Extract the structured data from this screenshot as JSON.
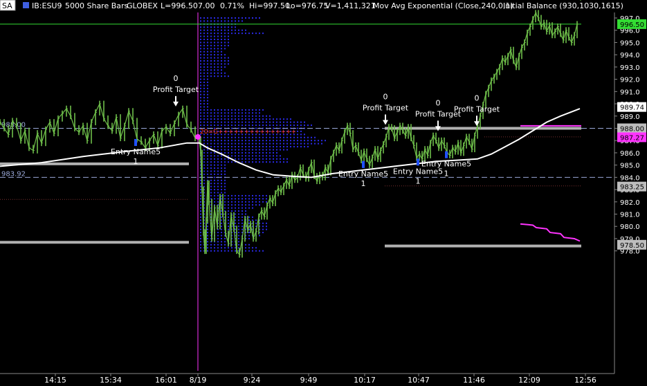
{
  "header": {
    "symbol_button": "SA",
    "symbol": "IB:ESU9",
    "bar_type": "5000 Share Bars",
    "exchange": "GLOBEX",
    "last": "L=996.50",
    "change": "7.00",
    "change_pct": "0.71%",
    "high": "Hi=997.50",
    "low": "Lo=976.75",
    "volume": "V=1,411,321",
    "study1": "Mov Avg Exponential (Close,240,0,1)",
    "study2": "Initial Balance (930,1030,1615)"
  },
  "colors": {
    "background": "#000000",
    "bars": "#6fbf4a",
    "moving_average": "#ffffff",
    "volume_profile": "#2a2ae6",
    "highlight_line": "#33dd33",
    "magenta": "#ff33ff",
    "ib_gray": "#b0b0b0",
    "dashed_level": "#9aa8d8",
    "last_badge": "#33dd33"
  },
  "chart_data": {
    "type": "line",
    "symbol": "IB:ESU9",
    "x_labels": [
      "14:15",
      "15:34",
      "16:01",
      "8/19",
      "9:24",
      "9:49",
      "10:17",
      "10:47",
      "11:46",
      "12:09",
      "12:56"
    ],
    "ylim": [
      977.5,
      997.5
    ],
    "y_ticks": [
      978.0,
      979.0,
      980.0,
      981.0,
      982.0,
      983.0,
      984.0,
      985.0,
      986.0,
      987.0,
      988.0,
      989.0,
      990.0,
      991.0,
      992.0,
      993.0,
      994.0,
      995.0,
      996.0,
      997.0
    ],
    "price_series": {
      "name": "IB:ESU9",
      "x": [
        0,
        6,
        12,
        18,
        24,
        30,
        36,
        42,
        48,
        54,
        60,
        66,
        72,
        78,
        84,
        90,
        96,
        102,
        108,
        114,
        120,
        126,
        132,
        138,
        144,
        150,
        156,
        162,
        168,
        174,
        180,
        186,
        192,
        198,
        204,
        210,
        216,
        222,
        228,
        234,
        240,
        246,
        252,
        258,
        264,
        270,
        276,
        282,
        288,
        290,
        292,
        294,
        296,
        298,
        300,
        302,
        306,
        310,
        314,
        318,
        322,
        326,
        330,
        334,
        338,
        342,
        346,
        350,
        354,
        358,
        362,
        366,
        370,
        374,
        378,
        382,
        386,
        390,
        394,
        398,
        402,
        406,
        410,
        414,
        418,
        422,
        426,
        430,
        434,
        438,
        442,
        446,
        450,
        454,
        458,
        462,
        466,
        470,
        474,
        478,
        482,
        486,
        490,
        494,
        498,
        502,
        506,
        510,
        514,
        518,
        522,
        526,
        530,
        534,
        538,
        542,
        546,
        550,
        554,
        558,
        562,
        566,
        570,
        574,
        578,
        582,
        586,
        590,
        594,
        598,
        602,
        606,
        610,
        614,
        618,
        622,
        626,
        630,
        634,
        638,
        642,
        646,
        650,
        654,
        658,
        662,
        666,
        670,
        674,
        678,
        682,
        686,
        690,
        694,
        698,
        702,
        706,
        710,
        714,
        718,
        722,
        726,
        730,
        734,
        738,
        742,
        746,
        750,
        754,
        758,
        762,
        766,
        770,
        774,
        778,
        782,
        786,
        790,
        794,
        798,
        802,
        806,
        810,
        814,
        818,
        822,
        826,
        830,
        834,
        838
      ],
      "y": [
        988.5,
        988.0,
        987.5,
        988.6,
        988.2,
        987.0,
        987.8,
        986.4,
        986.2,
        987.6,
        986.8,
        987.9,
        988.5,
        987.6,
        988.8,
        989.2,
        989.6,
        989.0,
        988.0,
        987.7,
        988.2,
        987.0,
        988.5,
        989.3,
        990.0,
        988.8,
        988.2,
        987.8,
        988.9,
        987.2,
        988.2,
        989.4,
        988.6,
        987.1,
        986.9,
        986.4,
        987.0,
        987.5,
        986.6,
        987.8,
        988.1,
        987.6,
        988.4,
        989.1,
        989.6,
        988.3,
        987.9,
        987.2,
        987.1,
        986.0,
        983.0,
        979.5,
        978.0,
        980.5,
        983.5,
        982.0,
        979.0,
        981.5,
        980.0,
        982.4,
        981.0,
        979.4,
        978.6,
        980.9,
        979.8,
        978.0,
        977.7,
        979.0,
        980.6,
        979.7,
        980.2,
        979.0,
        979.6,
        980.8,
        981.3,
        980.8,
        981.7,
        982.3,
        981.9,
        982.7,
        983.1,
        982.8,
        983.3,
        983.8,
        983.3,
        984.2,
        983.8,
        984.0,
        984.8,
        984.2,
        983.9,
        984.6,
        985.2,
        984.1,
        983.7,
        984.2,
        984.0,
        984.8,
        984.4,
        985.5,
        986.0,
        986.6,
        986.2,
        987.0,
        987.7,
        988.2,
        987.6,
        986.3,
        986.6,
        986.0,
        985.4,
        986.1,
        985.5,
        985.0,
        985.6,
        986.3,
        985.5,
        986.2,
        986.7,
        987.3,
        988.1,
        988.0,
        987.2,
        987.7,
        988.2,
        987.8,
        987.4,
        988.1,
        987.2,
        986.6,
        985.6,
        985.9,
        985.5,
        986.3,
        985.8,
        986.8,
        987.4,
        987.0,
        986.4,
        987.0,
        986.6,
        986.0,
        985.8,
        986.4,
        986.1,
        986.8,
        986.0,
        986.6,
        987.3,
        986.9,
        986.3,
        987.4,
        988.2,
        989.0,
        989.9,
        990.8,
        991.3,
        991.9,
        992.2,
        992.6,
        993.0,
        993.7,
        993.4,
        993.9,
        994.4,
        993.5,
        993.0,
        993.9,
        994.6,
        995.0,
        995.8,
        996.3,
        996.9,
        997.4,
        997.0,
        996.3,
        996.6,
        995.9,
        996.4,
        995.6,
        995.9,
        996.3,
        995.7,
        995.2,
        996.0,
        995.4,
        995.0,
        995.6,
        996.5
      ]
    },
    "moving_average": {
      "name": "Mov Avg Exponential (Close,240,0,1)",
      "x": [
        0,
        60,
        120,
        180,
        230,
        270,
        288,
        300,
        320,
        345,
        370,
        395,
        420,
        450,
        480,
        510,
        540,
        570,
        600,
        630,
        660,
        690,
        710,
        730,
        750,
        770,
        790,
        810,
        838
      ],
      "y": [
        984.9,
        985.2,
        985.7,
        986.1,
        986.4,
        986.8,
        986.8,
        986.4,
        985.9,
        985.2,
        984.6,
        984.2,
        984.1,
        984.0,
        984.3,
        984.5,
        984.7,
        984.9,
        985.1,
        985.3,
        985.4,
        985.5,
        985.9,
        986.5,
        987.1,
        987.8,
        988.5,
        989.0,
        989.6
      ]
    },
    "reference_levels": [
      {
        "label": "988.00",
        "value": 988.0,
        "style": "dashed"
      },
      {
        "label": "983.92",
        "value": 984.0,
        "style": "dashed"
      },
      {
        "label": "996.50",
        "value": 996.5,
        "style": "solid-green"
      }
    ],
    "price_badges": [
      {
        "text": "997.00",
        "value": 997.0,
        "kind": "tick"
      },
      {
        "text": "996.50",
        "value": 996.5,
        "kind": "last"
      },
      {
        "text": "989.74",
        "value": 989.74,
        "kind": "ma"
      },
      {
        "text": "988.00",
        "value": 988.0,
        "kind": "gray"
      },
      {
        "text": "987.27",
        "value": 987.27,
        "kind": "magenta"
      },
      {
        "text": "983.25",
        "value": 983.25,
        "kind": "gray"
      },
      {
        "text": "978.50",
        "value": 978.5,
        "kind": "gray"
      }
    ],
    "annotations": [
      {
        "type": "profit_target",
        "label": "Profit Target",
        "qty": "0",
        "x": 254,
        "y": 989.5
      },
      {
        "type": "profit_target",
        "label": "Profit Target",
        "qty": "0",
        "x": 557,
        "y": 988.0
      },
      {
        "type": "profit_target",
        "label": "Profit Target",
        "qty": "0",
        "x": 633,
        "y": 987.5
      },
      {
        "type": "profit_target",
        "label": "Profit Target",
        "qty": "0",
        "x": 689,
        "y": 987.9
      },
      {
        "type": "entry",
        "label": "Entry Name5",
        "qty": "1",
        "x": 196,
        "y": 986.9
      },
      {
        "type": "entry",
        "label": "Entry Name5",
        "qty": "1",
        "x": 525,
        "y": 985.1
      },
      {
        "type": "entry",
        "label": "Entry Name5",
        "qty": "1",
        "x": 604,
        "y": 985.3
      },
      {
        "type": "entry",
        "label": "Entry Name5",
        "qty": "1",
        "x": 645,
        "y": 985.9
      }
    ],
    "profile_label": "20=G+++++++++++++++"
  }
}
